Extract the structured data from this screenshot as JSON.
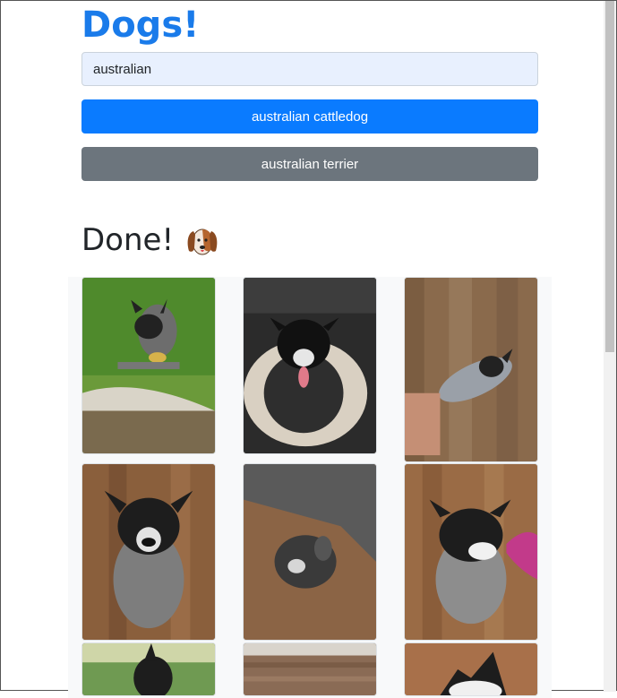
{
  "app": {
    "title": "Dogs!"
  },
  "search": {
    "value": "australian"
  },
  "suggestions": [
    {
      "label": "australian cattledog",
      "variant": "primary"
    },
    {
      "label": "australian terrier",
      "variant": "secondary"
    }
  ],
  "status": {
    "text": "Done!",
    "icon": "dog-face-icon"
  },
  "gallery": {
    "photos": [
      {
        "name": "dog-photo-1",
        "scene": "grass"
      },
      {
        "name": "dog-photo-2",
        "scene": "car-seat"
      },
      {
        "name": "dog-photo-3",
        "scene": "wood-floor"
      },
      {
        "name": "dog-photo-4",
        "scene": "wood-floor"
      },
      {
        "name": "dog-photo-5",
        "scene": "couch-floor"
      },
      {
        "name": "dog-photo-6",
        "scene": "wood-floor"
      },
      {
        "name": "dog-photo-7",
        "scene": "grass"
      },
      {
        "name": "dog-photo-8",
        "scene": "wood-floor"
      },
      {
        "name": "dog-photo-9",
        "scene": "wood-floor"
      }
    ]
  },
  "colors": {
    "title": "#1a7bea",
    "primary": "#0a7bff",
    "secondary": "#6c757d",
    "input_bg": "#e8f0fe"
  }
}
